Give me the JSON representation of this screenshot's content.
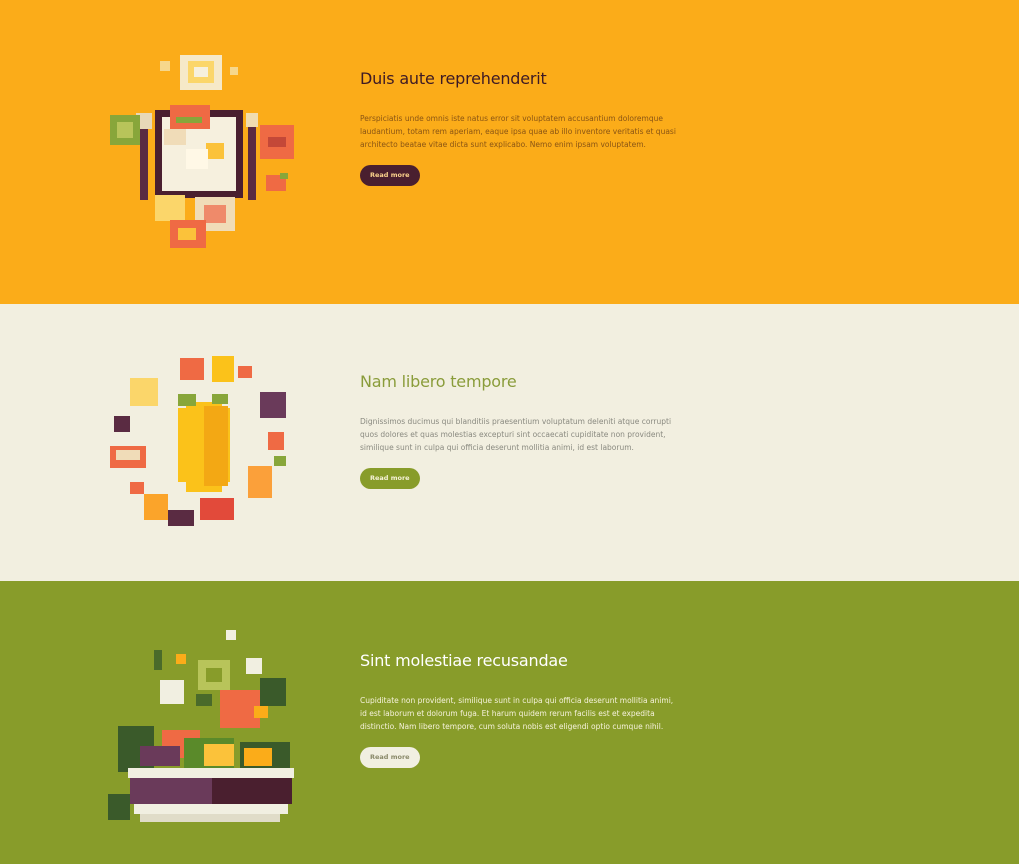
{
  "sections": [
    {
      "heading": "Duis aute reprehenderit",
      "body": "Perspiciatis unde omnis iste natus error sit voluptatem accusantium doloremque laudantium, totam rem aperiam, eaque ipsa quae ab illo inventore veritatis et quasi architecto beatae vitae dicta sunt explicabo. Nemo enim ipsam voluptatem.",
      "button": "Read more",
      "illustration": "plate-with-food-icon",
      "bg": "#fbac19"
    },
    {
      "heading": "Nam libero tempore",
      "body": "Dignissimos ducimus qui blanditiis praesentium voluptatum deleniti atque corrupti quos dolores et quas molestias excepturi sint occaecati cupiditate non provident, similique sunt in culpa qui officia deserunt mollitia animi, id est laborum.",
      "button": "Read more",
      "illustration": "fruit-ring-lemon-icon",
      "bg": "#f2efe0"
    },
    {
      "heading": "Sint molestiae recusandae",
      "body": "Cupiditate non provident, similique sunt in culpa qui officia deserunt mollitia animi, id est laborum et dolorum fuga. Et harum quidem rerum facilis est et expedita distinctio. Nam libero tempore, cum soluta nobis est eligendi optio cumque nihil.",
      "button": "Read more",
      "illustration": "salad-bowl-icon",
      "bg": "#889c2a"
    }
  ]
}
